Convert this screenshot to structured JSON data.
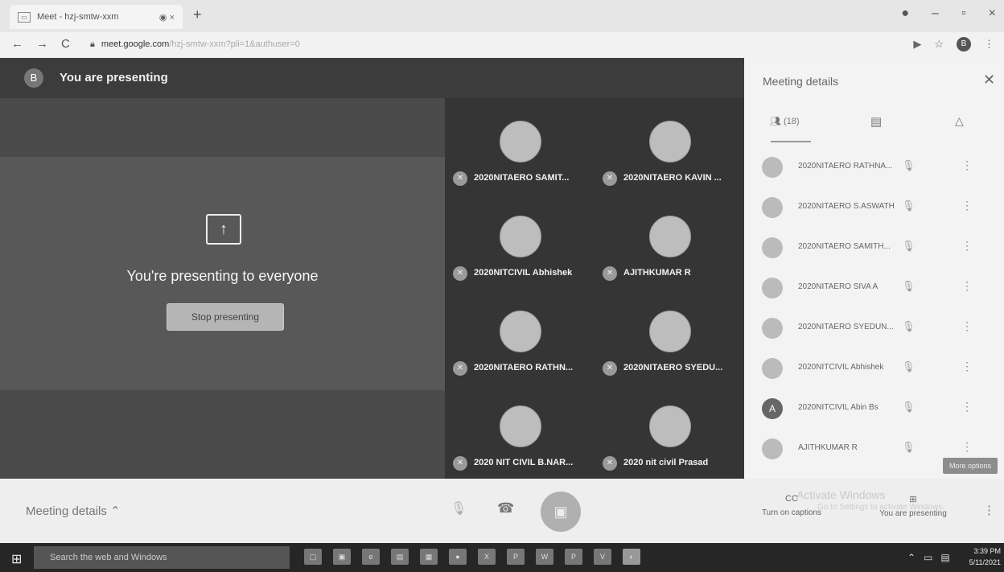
{
  "browser": {
    "tab_title": "Meet - hzj-smtw-xxm",
    "tab_controls": "◉ ×",
    "new_tab": "+",
    "nav_back": "←",
    "nav_forward": "→",
    "nav_reload": "C",
    "url_host": "meet.google.com",
    "url_path": "/hzj-smtw-xxm?pli=1&authuser=0",
    "profile_initial": "B",
    "win_min": "–",
    "win_max": "▫",
    "win_close": "×"
  },
  "stage": {
    "presenter_initial": "B",
    "presenting_banner": "You are presenting",
    "presenting_to_everyone": "You're presenting to everyone",
    "stop_presenting": "Stop presenting"
  },
  "tiles": [
    {
      "name": "2020NITAERO SAMIT..."
    },
    {
      "name": "2020NITAERO KAVIN ..."
    },
    {
      "name": "2020NITCIVIL Abhishek"
    },
    {
      "name": "AJITHKUMAR R"
    },
    {
      "name": "2020NITAERO RATHN..."
    },
    {
      "name": "2020NITAERO SYEDU..."
    },
    {
      "name": "2020 NIT CIVIL B.NAR..."
    },
    {
      "name": "2020 nit civil Prasad"
    }
  ],
  "panel": {
    "title": "Meeting details",
    "people_count": "(18)",
    "participants": [
      {
        "name": "2020NITAERO RATHNA...",
        "initial": ""
      },
      {
        "name": "2020NITAERO S.ASWATH",
        "initial": ""
      },
      {
        "name": "2020NITAERO SAMITH...",
        "initial": ""
      },
      {
        "name": "2020NITAERO SIVA A",
        "initial": ""
      },
      {
        "name": "2020NITAERO SYEDUN...",
        "initial": ""
      },
      {
        "name": "2020NITCIVIL Abhishek",
        "initial": ""
      },
      {
        "name": "2020NITCIVIL Abin Bs",
        "initial": "A"
      },
      {
        "name": "AJITHKUMAR R",
        "initial": ""
      }
    ],
    "tooltip": "More options"
  },
  "bottom": {
    "meeting_details": "Meeting details",
    "captions_label": "Turn on captions",
    "present_label": "You are presenting",
    "watermark_line1": "Activate Windows",
    "watermark_line2": "Go to Settings to activate Windows."
  },
  "taskbar": {
    "search_placeholder": "Search the web and Windows",
    "time": "3:39 PM",
    "date": "5/11/2021",
    "apps": [
      "▢",
      "▣",
      "e",
      "▤",
      "▦",
      "●",
      "X",
      "P",
      "W",
      "P",
      "V",
      "◐"
    ]
  }
}
